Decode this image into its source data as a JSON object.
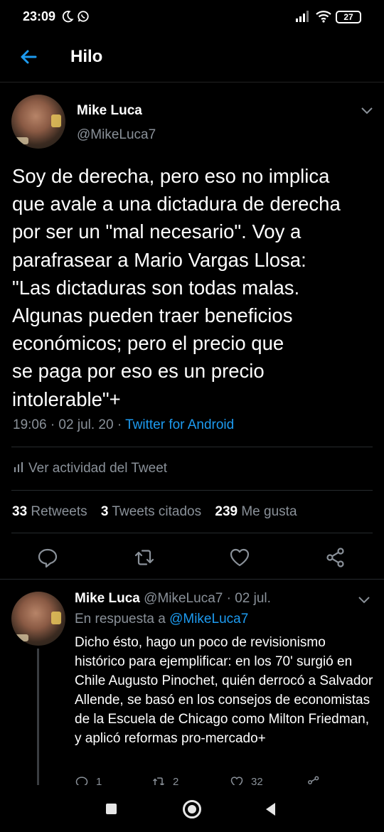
{
  "status_bar": {
    "time": "23:09",
    "battery": "27"
  },
  "header": {
    "title": "Hilo"
  },
  "main_tweet": {
    "name": "Mike Luca",
    "handle": "@MikeLuca7",
    "text": "Soy de derecha, pero eso no implica\nque avale a una dictadura de derecha\npor ser un \"mal necesario\". Voy a\nparafrasear a Mario Vargas Llosa:\n\"Las dictaduras son todas malas.\nAlgunas pueden traer beneficios\neconómicos; pero el precio que\nse paga por eso es un precio\nintolerable\"+",
    "datetime": "19:06 · 02 jul. 20 · ",
    "source": "Twitter for Android",
    "activity_label": "Ver actividad del Tweet",
    "retweets_count": "33",
    "retweets_label": "Retweets",
    "quotes_count": "3",
    "quotes_label": "Tweets citados",
    "likes_count": "239",
    "likes_label": "Me gusta"
  },
  "reply_tweet": {
    "name": "Mike Luca",
    "handle_date": "@MikeLuca7 · 02 jul.",
    "reply_prefix": "En respuesta a ",
    "reply_mention": "@MikeLuca7",
    "text": "Dicho ésto, hago un poco de revisionismo histórico para ejemplificar: en los 70' surgió en Chile Augusto Pinochet, quién derrocó a Salvador Allende, se basó en los consejos de economistas de la Escuela de Chicago como Milton Friedman, y aplicó reformas pro-mercado+",
    "reply_count": "1",
    "retweet_count": "2",
    "like_count": "32"
  },
  "icons": {
    "back": "arrow-left-icon",
    "reply": "comment-icon",
    "retweet": "retweet-icon",
    "like": "heart-icon",
    "share": "share-icon",
    "menu": "chevron-down-icon"
  },
  "colors": {
    "background": "#000000",
    "accent": "#1d9bf0",
    "muted": "#8a9199",
    "text": "#ffffff"
  }
}
